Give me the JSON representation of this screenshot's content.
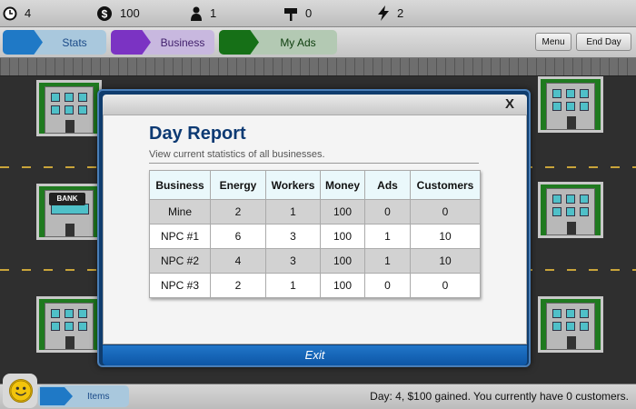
{
  "resources": {
    "days": "4",
    "money": "100",
    "workers": "1",
    "ads": "0",
    "energy": "2"
  },
  "tabs": {
    "stats": "Stats",
    "business": "Business",
    "my_ads": "My Ads"
  },
  "toolbar": {
    "menu": "Menu",
    "end_day": "End Day"
  },
  "city": {
    "bank_sign": "BANK"
  },
  "modal": {
    "close": "X",
    "title": "Day Report",
    "subtitle": "View current statistics of all businesses.",
    "exit": "Exit",
    "table": {
      "headers": [
        "Business",
        "Energy",
        "Workers",
        "Money",
        "Ads",
        "Customers"
      ],
      "rows": [
        [
          "Mine",
          "2",
          "1",
          "100",
          "0",
          "0"
        ],
        [
          "NPC #1",
          "6",
          "3",
          "100",
          "1",
          "10"
        ],
        [
          "NPC #2",
          "4",
          "3",
          "100",
          "1",
          "10"
        ],
        [
          "NPC #3",
          "2",
          "1",
          "100",
          "0",
          "0"
        ]
      ]
    }
  },
  "bottom": {
    "items_tab": "Items",
    "status": "Day: 4, $100 gained. You currently have 0 customers."
  },
  "colors": {
    "stats_tab": "#1f79c6",
    "business_tab": "#7b33c3",
    "my_ads_tab": "#167017",
    "modal_frame": "#0f3c6d",
    "title": "#0d3a73"
  }
}
